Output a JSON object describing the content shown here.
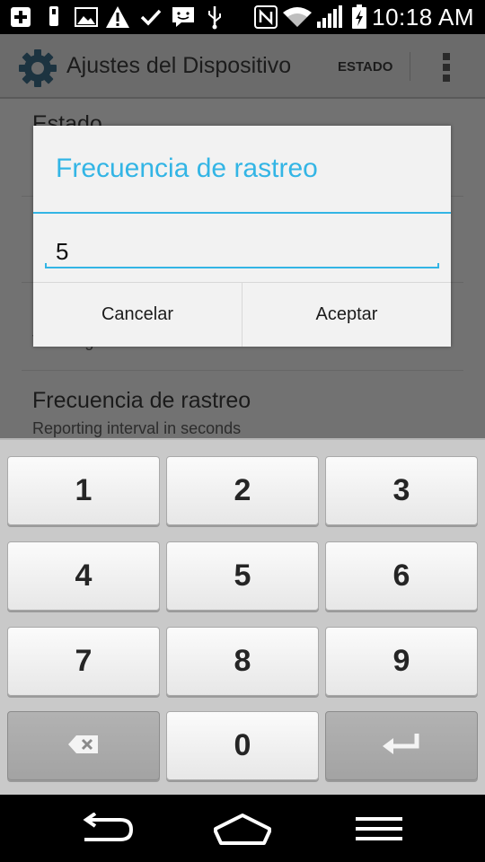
{
  "status_bar": {
    "time": "10:18 AM",
    "icons": [
      "plus-icon",
      "usb-icon",
      "image-icon",
      "warning-icon",
      "check-icon",
      "message-icon",
      "usb-icon",
      "nfc-icon",
      "wifi-icon",
      "signal-icon",
      "battery-charging-icon"
    ]
  },
  "app_bar": {
    "title": "Ajustes del Dispositivo",
    "estado_label": "ESTADO",
    "icon": "gear-icon",
    "overflow_icon": "overflow-menu-icon"
  },
  "settings_list": {
    "items": [
      {
        "title": "Estado",
        "subtitle": ""
      },
      {
        "title": "",
        "subtitle": "Tracking server URL"
      },
      {
        "title": "Frecuencia de rastreo",
        "subtitle": "Reporting interval in seconds"
      }
    ]
  },
  "dialog": {
    "title": "Frecuencia de rastreo",
    "input_value": "5",
    "cancel_label": "Cancelar",
    "accept_label": "Aceptar"
  },
  "keypad": {
    "keys": [
      "1",
      "2",
      "3",
      "4",
      "5",
      "6",
      "7",
      "8",
      "9",
      "backspace-icon",
      "0",
      "enter-icon"
    ]
  },
  "nav_bar": {
    "buttons": [
      "back-icon",
      "home-icon",
      "menu-icon"
    ]
  },
  "colors": {
    "accent": "#33b5e5",
    "dim_overlay": "#707070",
    "keypad_bg": "#c9c9c9"
  }
}
